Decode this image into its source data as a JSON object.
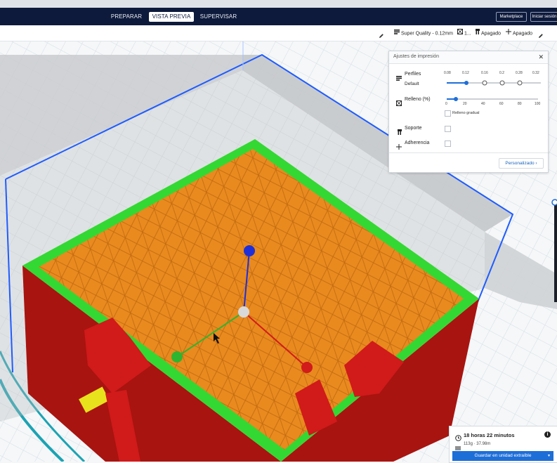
{
  "header": {
    "stages": [
      {
        "label": "PREPARAR",
        "active": false
      },
      {
        "label": "VISTA PREVIA",
        "active": true
      },
      {
        "label": "SUPERVISAR",
        "active": false
      }
    ],
    "marketplace_label": "Marketplace",
    "signin_label": "Iniciar sesión"
  },
  "toolbar": {
    "profile_text": "Super Quality - 0.12mm",
    "infill_text": "1...",
    "support_text": "Apagado",
    "adhesion_text": "Apagado"
  },
  "print_settings": {
    "title": "Ajustes de impresión",
    "profiles_label": "Perfiles",
    "profile_value": "Default",
    "layer_heights": [
      "0.08",
      "0.12",
      "0.16",
      "0.2",
      "0.28",
      "0.32"
    ],
    "selected_layer_height": "0.12",
    "infill_label": "Relleno (%)",
    "infill_ticks": [
      "0",
      "20",
      "40",
      "60",
      "80",
      "100"
    ],
    "infill_value_percent": 10,
    "gradual_infill_label": "Relleno gradual",
    "support_label": "Soporte",
    "adhesion_label": "Adherencia",
    "custom_button": "Personalizado"
  },
  "job": {
    "time": "18 horas 22 minutos",
    "material": "113g · 37.98m",
    "save_button": "Guardar en unidad extraíble"
  },
  "colors": {
    "header_bg": "#0e1a3b",
    "accent": "#1e6ed8",
    "walls": "#b31815",
    "infill": "#e98a1f",
    "skin": "#33d832",
    "outline": "#1f5cff"
  },
  "icons": {
    "profile": "layers-icon",
    "infill": "infill-icon",
    "support": "support-icon",
    "adhesion": "adhesion-icon",
    "edit": "pencil-icon",
    "close": "close-icon",
    "time": "clock-icon",
    "material": "spool-icon",
    "info": "info-icon"
  }
}
